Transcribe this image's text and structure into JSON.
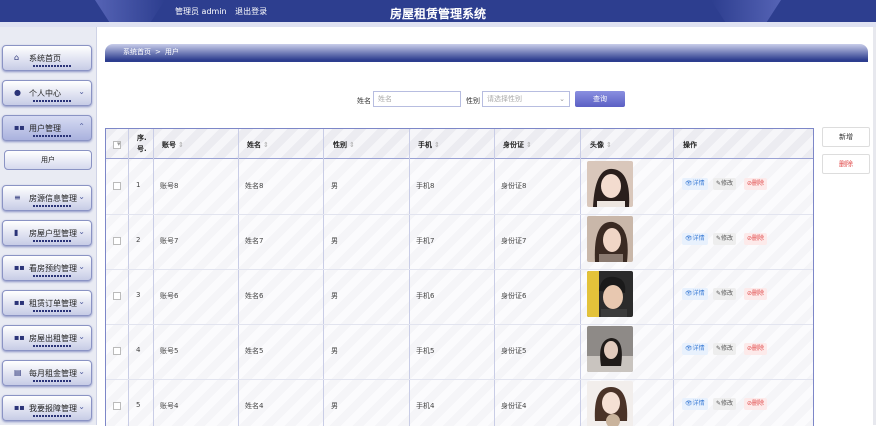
{
  "header": {
    "admin_label": "管理员 admin",
    "logout_label": "退出登录",
    "system_title": "房屋租赁管理系统"
  },
  "sidebar": {
    "items": [
      {
        "label": "系统首页",
        "icon": "home-icon"
      },
      {
        "label": "个人中心",
        "icon": "user-icon"
      },
      {
        "label": "用户管理",
        "icon": "grid-icon"
      },
      {
        "label": "房源信息管理",
        "icon": "sliders-icon"
      },
      {
        "label": "房屋户型管理",
        "icon": "chart-icon"
      },
      {
        "label": "看房预约管理",
        "icon": "grid-icon"
      },
      {
        "label": "租赁订单管理",
        "icon": "grid-icon"
      },
      {
        "label": "房屋出租管理",
        "icon": "grid-icon"
      },
      {
        "label": "每月租金管理",
        "icon": "table-icon"
      },
      {
        "label": "我要报障管理",
        "icon": "grid-icon"
      }
    ],
    "sub_item": "用户"
  },
  "breadcrumb": {
    "home": "系统首页",
    "sep": ">",
    "current": "用户"
  },
  "search": {
    "name_label": "姓名",
    "name_placeholder": "姓名",
    "gender_label": "性别",
    "gender_placeholder": "请选择性别",
    "query_button": "查询"
  },
  "actions": {
    "add": "新增",
    "delete": "删除"
  },
  "table": {
    "headers": {
      "index": "序号",
      "account": "账号",
      "name": "姓名",
      "gender": "性别",
      "phone": "手机",
      "id_card": "身份证",
      "avatar": "头像",
      "ops": "操作"
    },
    "index_header_lines": [
      "序.",
      "号."
    ],
    "ops": {
      "detail": "详情",
      "edit": "修改",
      "delete": "删除"
    },
    "rows": [
      {
        "index": "1",
        "account": "账号8",
        "name": "姓名8",
        "gender": "男",
        "phone": "手机8",
        "id_card": "身份证8"
      },
      {
        "index": "2",
        "account": "账号7",
        "name": "姓名7",
        "gender": "男",
        "phone": "手机7",
        "id_card": "身份证7"
      },
      {
        "index": "3",
        "account": "账号6",
        "name": "姓名6",
        "gender": "男",
        "phone": "手机6",
        "id_card": "身份证6"
      },
      {
        "index": "4",
        "account": "账号5",
        "name": "姓名5",
        "gender": "男",
        "phone": "手机5",
        "id_card": "身份证5"
      },
      {
        "index": "5",
        "account": "账号4",
        "name": "姓名4",
        "gender": "男",
        "phone": "手机4",
        "id_card": "身份证4"
      }
    ]
  },
  "colors": {
    "brand": "#2d3e8f",
    "accent": "#5b5fc4",
    "danger": "#e04848"
  }
}
